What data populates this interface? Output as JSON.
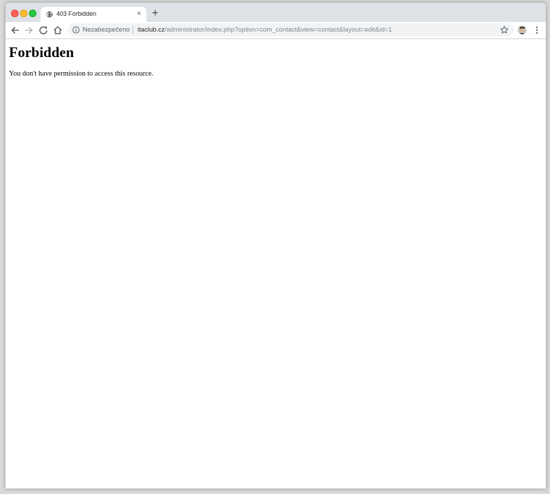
{
  "browser": {
    "tab": {
      "title": "403 Forbidden",
      "favicon": "globe-icon",
      "close_glyph": "×"
    },
    "new_tab_glyph": "+",
    "toolbar": {
      "security_label": "Nezabezpečeno",
      "url_host": "itaclub.cz",
      "url_path": "/administrator/index.php?option=com_contact&view=contact&layout=edit&id=1",
      "icons": [
        "back-arrow-icon",
        "forward-arrow-icon",
        "reload-icon",
        "home-icon",
        "info-icon",
        "star-icon",
        "avatar",
        "more-menu-icon"
      ]
    },
    "colors": {
      "tabstrip": "#dee1e6",
      "omnibox": "#f1f3f4",
      "traffic_close": "#fe5f57",
      "traffic_min": "#febc2e",
      "traffic_max": "#28c840"
    }
  },
  "page": {
    "heading": "Forbidden",
    "message": "You don't have permission to access this resource."
  }
}
